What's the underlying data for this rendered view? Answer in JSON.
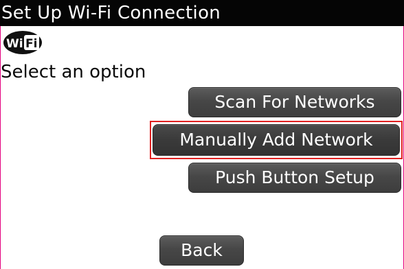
{
  "window": {
    "title": "Set Up Wi-Fi Connection"
  },
  "logo": {
    "icon": "wifi-logo-icon",
    "text_left": "Wi",
    "text_right": "Fi"
  },
  "prompt": "Select an option",
  "options": {
    "scan": "Scan For Networks",
    "manual": "Manually Add Network",
    "push": "Push Button Setup"
  },
  "back_label": "Back",
  "focused_option": "manual",
  "colors": {
    "title_bar": "#050505",
    "button": "#474747",
    "focus_ring": "#e02020"
  }
}
